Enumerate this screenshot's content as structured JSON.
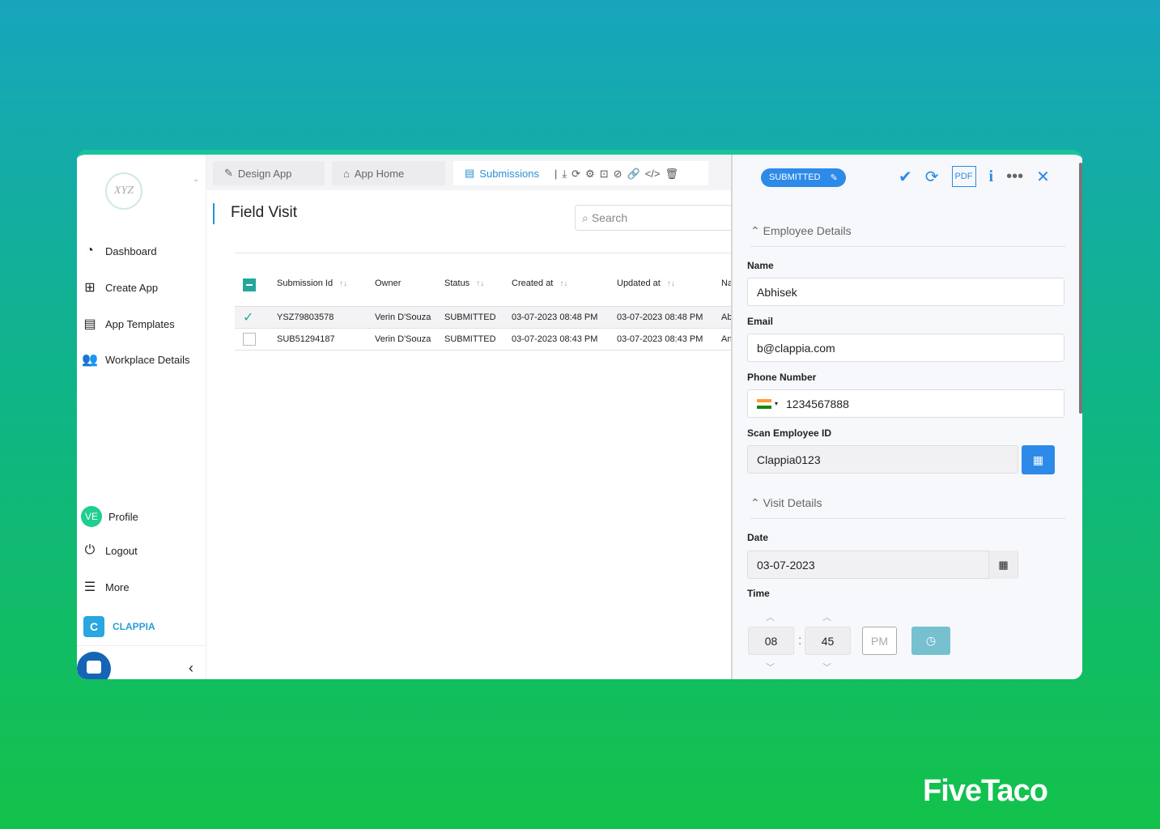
{
  "sidebar": {
    "logo_text": "XYZ",
    "items": [
      {
        "label": "Dashboard",
        "icon": "gauge-icon"
      },
      {
        "label": "Create App",
        "icon": "grid-plus-icon"
      },
      {
        "label": "App Templates",
        "icon": "template-icon"
      },
      {
        "label": "Workplace Details",
        "icon": "users-icon"
      }
    ],
    "profile": {
      "initials": "VE",
      "label": "Profile"
    },
    "logout": "Logout",
    "more": "More",
    "brand": "CLAPPIA"
  },
  "tabs": [
    {
      "label": "Design App"
    },
    {
      "label": "App Home"
    },
    {
      "label": "Submissions",
      "active": true
    }
  ],
  "main": {
    "title": "Field Visit",
    "search_placeholder": "Search",
    "columns": [
      "Submission Id",
      "Owner",
      "Status",
      "Created at",
      "Updated at",
      "Na"
    ],
    "rows": [
      {
        "id": "YSZ79803578",
        "owner": "Verin D'Souza",
        "status": "SUBMITTED",
        "created": "03-07-2023 08:48 PM",
        "updated": "03-07-2023 08:48 PM",
        "name": "Ab",
        "selected": true
      },
      {
        "id": "SUB51294187",
        "owner": "Verin D'Souza",
        "status": "SUBMITTED",
        "created": "03-07-2023 08:43 PM",
        "updated": "03-07-2023 08:43 PM",
        "name": "An",
        "selected": false
      }
    ]
  },
  "panel": {
    "status": "SUBMITTED",
    "sections": {
      "employee": "Employee Details",
      "visit": "Visit Details"
    },
    "fields": {
      "name_label": "Name",
      "name": "Abhisek",
      "email_label": "Email",
      "email": "b@clappia.com",
      "phone_label": "Phone Number",
      "phone": "1234567888",
      "scan_label": "Scan Employee ID",
      "scan": "Clappia0123",
      "date_label": "Date",
      "date": "03-07-2023",
      "time_label": "Time",
      "hour": "08",
      "minute": "45",
      "ampm": "PM"
    }
  },
  "watermark": "FiveTaco",
  "colors": {
    "accent": "#2d8ae8",
    "teal": "#23a79a",
    "bg_top": "#17a5bd",
    "bg_bottom": "#12c24a"
  }
}
